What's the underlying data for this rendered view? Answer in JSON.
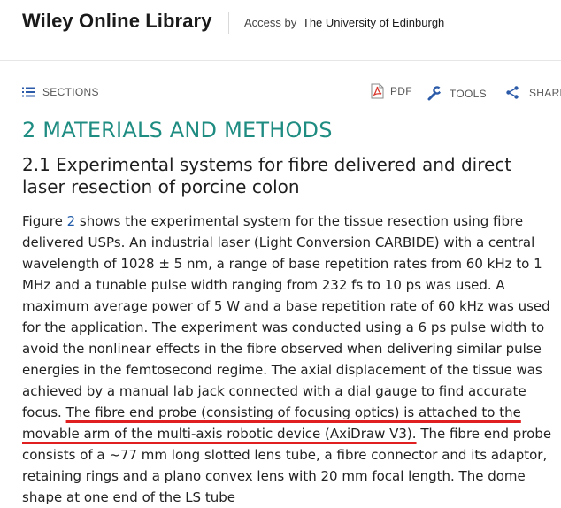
{
  "header": {
    "brand": "Wiley Online Library",
    "access_label": "Access by",
    "access_org": "The University of Edinburgh"
  },
  "toolbar": {
    "sections_label": "SECTIONS",
    "pdf_label": "PDF",
    "tools_label": "TOOLS",
    "share_label": "SHARE"
  },
  "article": {
    "section_heading": "2 MATERIALS AND METHODS",
    "subsection_heading": "2.1 Experimental systems for fibre delivered and direct laser resection of porcine colon",
    "para": {
      "figure_word": "Figure ",
      "figure_link": "2",
      "text_before_highlight": " shows the experimental system for the tissue resection using fibre delivered USPs. An industrial laser (Light Conversion CARBIDE) with a central wavelength of 1028 ± 5 nm, a range of base repetition rates from 60 kHz to 1 MHz and a tunable pulse width ranging from 232 fs to 10 ps was used. A maximum average power of 5 W and a base repetition rate of 60 kHz was used for the application. The experiment was conducted using a 6 ps pulse width to avoid the nonlinear effects in the fibre observed when delivering similar pulse energies in the femtosecond regime. The axial displacement of the tissue was achieved by a manual lab jack connected with a dial gauge to find accurate focus. ",
      "highlighted_text": "The fibre end probe (consisting of focusing optics) is attached to the movable arm of the multi-axis robotic device (AxiDraw V3).",
      "text_after_highlight": " The fibre end probe consists of a ~77 mm long slotted lens tube, a fibre connector and its adaptor, retaining rings and a plano convex lens with 20 mm focal length. The dome shape at one end of the LS tube"
    }
  },
  "colors": {
    "heading_teal": "#1f8c82",
    "link_blue": "#1e5aa8",
    "annotation_red": "#e02020",
    "pdf_icon_red": "#d9342b"
  }
}
